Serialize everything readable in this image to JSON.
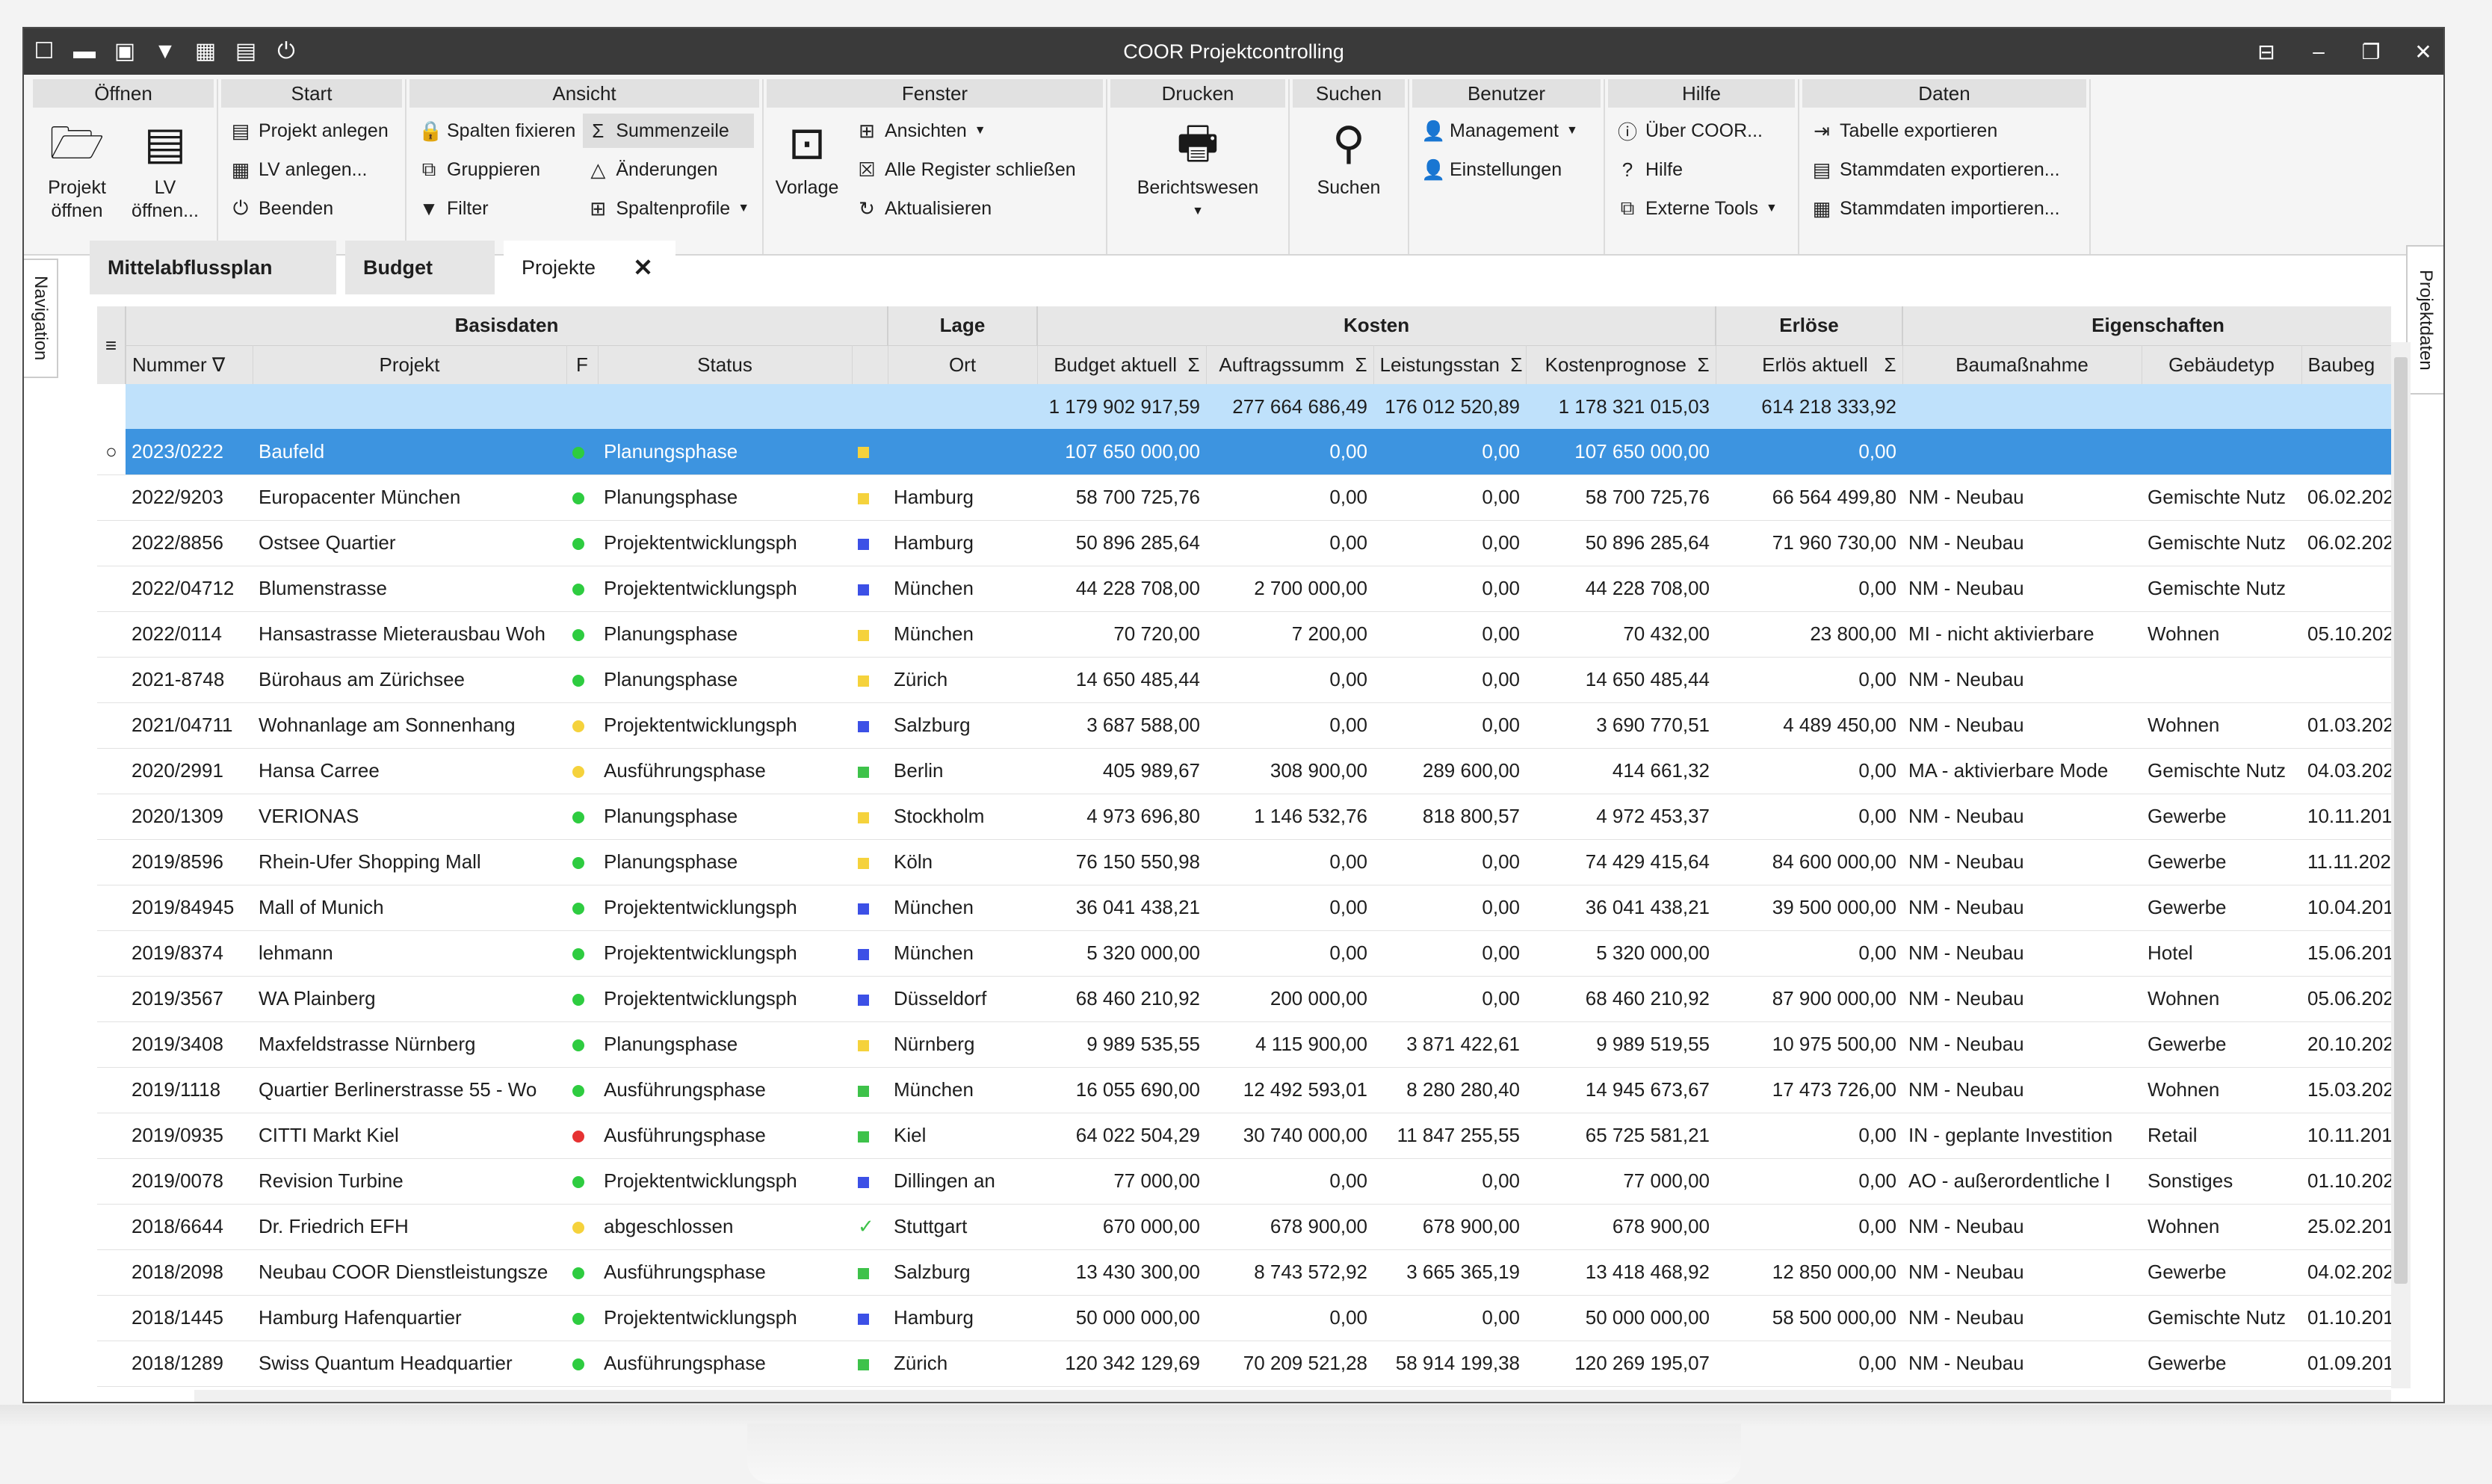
{
  "app": {
    "title": "COOR Projektcontrolling"
  },
  "toolbar_icons": [
    "window-icon",
    "folder-open-icon",
    "print-icon",
    "filter-icon",
    "calculator-icon",
    "layout-icon",
    "power-icon"
  ],
  "ribbon": {
    "oeffnen": {
      "header": "Öffnen",
      "projekt": "Projekt\nöffnen",
      "lv": "LV\nöffnen..."
    },
    "start": {
      "header": "Start",
      "items": [
        "Projekt anlegen",
        "LV anlegen...",
        "Beenden"
      ]
    },
    "ansicht": {
      "header": "Ansicht",
      "col1": [
        "Spalten fixieren",
        "Gruppieren",
        "Filter"
      ],
      "col2": [
        "Summenzeile",
        "Änderungen",
        "Spaltenprofile"
      ]
    },
    "fenster": {
      "header": "Fenster",
      "vorlage": "Vorlage",
      "items": [
        "Ansichten",
        "Alle Register schließen",
        "Aktualisieren"
      ]
    },
    "drucken": {
      "header": "Drucken",
      "berichtswesen": "Berichtswesen"
    },
    "suchen": {
      "header": "Suchen",
      "suchen": "Suchen"
    },
    "benutzer": {
      "header": "Benutzer",
      "items": [
        "Management",
        "Einstellungen"
      ]
    },
    "hilfe": {
      "header": "Hilfe",
      "items": [
        "Über COOR...",
        "Hilfe",
        "Externe Tools"
      ]
    },
    "daten": {
      "header": "Daten",
      "items": [
        "Tabelle exportieren",
        "Stammdaten exportieren...",
        "Stammdaten importieren..."
      ]
    }
  },
  "side": {
    "navigation": "Navigation",
    "projektdaten": "Projektdaten"
  },
  "tabs": [
    {
      "label": "Mittelabflussplan"
    },
    {
      "label": "Budget"
    },
    {
      "label": "Projekte"
    }
  ],
  "tab_close": "✕",
  "grid": {
    "groups": [
      "Basisdaten",
      "Lage",
      "Kosten",
      "Erlöse",
      "Eigenschaften"
    ],
    "columns": [
      "Nummer",
      "Projekt",
      "F",
      "Status",
      "",
      "Ort",
      "Budget aktuell",
      "Auftragssumm",
      "Leistungsstan",
      "Kostenprognose",
      "Erlös aktuell",
      "Baumaßnahme",
      "Gebäudetyp",
      "Baubeg"
    ],
    "sum_symbol": "Σ",
    "sums": {
      "budget": "1 179 902 917,59",
      "auftrag": "277 664 686,49",
      "leistung": "176 012 520,89",
      "prognose": "1 178 321 015,03",
      "erloes": "614 218 333,92"
    },
    "rows": [
      {
        "nr": "2023/0222",
        "projekt": "Baufeld",
        "f": "#2ecc40",
        "status": "Planungsphase",
        "lage": "#f5d23c",
        "ort": "",
        "budget": "107 650 000,00",
        "auftrag": "0,00",
        "leistung": "0,00",
        "prognose": "107 650 000,00",
        "erloes": "0,00",
        "bau": "",
        "typ": "",
        "beg": ""
      },
      {
        "nr": "2022/9203",
        "projekt": "Europacenter München",
        "f": "#2ecc40",
        "status": "Planungsphase",
        "lage": "#f5d23c",
        "ort": "Hamburg",
        "budget": "58 700 725,76",
        "auftrag": "0,00",
        "leistung": "0,00",
        "prognose": "58 700 725,76",
        "erloes": "66 564 499,80",
        "bau": "NM - Neubau",
        "typ": "Gemischte Nutz",
        "beg": "06.02.202"
      },
      {
        "nr": "2022/8856",
        "projekt": "Ostsee Quartier",
        "f": "#2ecc40",
        "status": "Projektentwicklungsph",
        "lage": "#3c50e6",
        "ort": "Hamburg",
        "budget": "50 896 285,64",
        "auftrag": "0,00",
        "leistung": "0,00",
        "prognose": "50 896 285,64",
        "erloes": "71 960 730,00",
        "bau": "NM - Neubau",
        "typ": "Gemischte Nutz",
        "beg": "06.02.202"
      },
      {
        "nr": "2022/04712",
        "projekt": "Blumenstrasse",
        "f": "#2ecc40",
        "status": "Projektentwicklungsph",
        "lage": "#3c50e6",
        "ort": "München",
        "budget": "44 228 708,00",
        "auftrag": "2 700 000,00",
        "leistung": "0,00",
        "prognose": "44 228 708,00",
        "erloes": "0,00",
        "bau": "NM - Neubau",
        "typ": "Gemischte Nutz",
        "beg": ""
      },
      {
        "nr": "2022/0114",
        "projekt": "Hansastrasse Mieterausbau Woh",
        "f": "#2ecc40",
        "status": "Planungsphase",
        "lage": "#f5d23c",
        "ort": "München",
        "budget": "70 720,00",
        "auftrag": "7 200,00",
        "leistung": "0,00",
        "prognose": "70 432,00",
        "erloes": "23 800,00",
        "bau": "MI - nicht aktivierbare",
        "typ": "Wohnen",
        "beg": "05.10.202"
      },
      {
        "nr": "2021-8748",
        "projekt": "Bürohaus am Zürichsee",
        "f": "#2ecc40",
        "status": "Planungsphase",
        "lage": "#f5d23c",
        "ort": "Zürich",
        "budget": "14 650 485,44",
        "auftrag": "0,00",
        "leistung": "0,00",
        "prognose": "14 650 485,44",
        "erloes": "0,00",
        "bau": "NM - Neubau",
        "typ": "",
        "beg": ""
      },
      {
        "nr": "2021/04711",
        "projekt": "Wohnanlage am Sonnenhang",
        "f": "#f5d23c",
        "status": "Projektentwicklungsph",
        "lage": "#3c50e6",
        "ort": "Salzburg",
        "budget": "3 687 588,00",
        "auftrag": "0,00",
        "leistung": "0,00",
        "prognose": "3 690 770,51",
        "erloes": "4 489 450,00",
        "bau": "NM - Neubau",
        "typ": "Wohnen",
        "beg": "01.03.202"
      },
      {
        "nr": "2020/2991",
        "projekt": "Hansa Carree",
        "f": "#f5d23c",
        "status": "Ausführungsphase",
        "lage": "#3ec24a",
        "ort": "Berlin",
        "budget": "405 989,67",
        "auftrag": "308 900,00",
        "leistung": "289 600,00",
        "prognose": "414 661,32",
        "erloes": "0,00",
        "bau": "MA - aktivierbare Mode",
        "typ": "Gemischte Nutz",
        "beg": "04.03.202"
      },
      {
        "nr": "2020/1309",
        "projekt": "VERIONAS",
        "f": "#2ecc40",
        "status": "Planungsphase",
        "lage": "#f5d23c",
        "ort": "Stockholm",
        "budget": "4 973 696,80",
        "auftrag": "1 146 532,76",
        "leistung": "818 800,57",
        "prognose": "4 972 453,37",
        "erloes": "0,00",
        "bau": "NM - Neubau",
        "typ": "Gewerbe",
        "beg": "10.11.201"
      },
      {
        "nr": "2019/8596",
        "projekt": "Rhein-Ufer Shopping Mall",
        "f": "#2ecc40",
        "status": "Planungsphase",
        "lage": "#f5d23c",
        "ort": "Köln",
        "budget": "76 150 550,98",
        "auftrag": "0,00",
        "leistung": "0,00",
        "prognose": "74 429 415,64",
        "erloes": "84 600 000,00",
        "bau": "NM - Neubau",
        "typ": "Gewerbe",
        "beg": "11.11.202"
      },
      {
        "nr": "2019/84945",
        "projekt": "Mall of Munich",
        "f": "#2ecc40",
        "status": "Projektentwicklungsph",
        "lage": "#3c50e6",
        "ort": "München",
        "budget": "36 041 438,21",
        "auftrag": "0,00",
        "leistung": "0,00",
        "prognose": "36 041 438,21",
        "erloes": "39 500 000,00",
        "bau": "NM - Neubau",
        "typ": "Gewerbe",
        "beg": "10.04.201"
      },
      {
        "nr": "2019/8374",
        "projekt": "lehmann",
        "f": "#2ecc40",
        "status": "Projektentwicklungsph",
        "lage": "#3c50e6",
        "ort": "München",
        "budget": "5 320 000,00",
        "auftrag": "0,00",
        "leistung": "0,00",
        "prognose": "5 320 000,00",
        "erloes": "0,00",
        "bau": "NM - Neubau",
        "typ": "Hotel",
        "beg": "15.06.201"
      },
      {
        "nr": "2019/3567",
        "projekt": "WA Plainberg",
        "f": "#2ecc40",
        "status": "Projektentwicklungsph",
        "lage": "#3c50e6",
        "ort": "Düsseldorf",
        "budget": "68 460 210,92",
        "auftrag": "200 000,00",
        "leistung": "0,00",
        "prognose": "68 460 210,92",
        "erloes": "87 900 000,00",
        "bau": "NM - Neubau",
        "typ": "Wohnen",
        "beg": "05.06.202"
      },
      {
        "nr": "2019/3408",
        "projekt": "Maxfeldstrasse Nürnberg",
        "f": "#2ecc40",
        "status": "Planungsphase",
        "lage": "#f5d23c",
        "ort": "Nürnberg",
        "budget": "9 989 535,55",
        "auftrag": "4 115 900,00",
        "leistung": "3 871 422,61",
        "prognose": "9 989 519,55",
        "erloes": "10 975 500,00",
        "bau": "NM - Neubau",
        "typ": "Gewerbe",
        "beg": "20.10.202"
      },
      {
        "nr": "2019/1118",
        "projekt": "Quartier Berlinerstrasse 55 - Wo",
        "f": "#2ecc40",
        "status": "Ausführungsphase",
        "lage": "#3ec24a",
        "ort": "München",
        "budget": "16 055 690,00",
        "auftrag": "12 492 593,01",
        "leistung": "8 280 280,40",
        "prognose": "14 945 673,67",
        "erloes": "17 473 726,00",
        "bau": "NM - Neubau",
        "typ": "Wohnen",
        "beg": "15.03.202"
      },
      {
        "nr": "2019/0935",
        "projekt": "CITTI Markt Kiel",
        "f": "#e63232",
        "status": "Ausführungsphase",
        "lage": "#3ec24a",
        "ort": "Kiel",
        "budget": "64 022 504,29",
        "auftrag": "30 740 000,00",
        "leistung": "11 847 255,55",
        "prognose": "65 725 581,21",
        "erloes": "0,00",
        "bau": "IN - geplante Investition",
        "typ": "Retail",
        "beg": "10.11.201"
      },
      {
        "nr": "2019/0078",
        "projekt": "Revision Turbine",
        "f": "#2ecc40",
        "status": "Projektentwicklungsph",
        "lage": "#3c50e6",
        "ort": "Dillingen an",
        "budget": "77 000,00",
        "auftrag": "0,00",
        "leistung": "0,00",
        "prognose": "77 000,00",
        "erloes": "0,00",
        "bau": "AO - außerordentliche I",
        "typ": "Sonstiges",
        "beg": "01.10.202"
      },
      {
        "nr": "2018/6644",
        "projekt": "Dr. Friedrich EFH",
        "f": "#f5d23c",
        "status": "abgeschlossen",
        "lage": "check",
        "ort": "Stuttgart",
        "budget": "670 000,00",
        "auftrag": "678 900,00",
        "leistung": "678 900,00",
        "prognose": "678 900,00",
        "erloes": "0,00",
        "bau": "NM - Neubau",
        "typ": "Wohnen",
        "beg": "25.02.201"
      },
      {
        "nr": "2018/2098",
        "projekt": "Neubau COOR Dienstleistungsze",
        "f": "#2ecc40",
        "status": "Ausführungsphase",
        "lage": "#3ec24a",
        "ort": "Salzburg",
        "budget": "13 430 300,00",
        "auftrag": "8 743 572,92",
        "leistung": "3 665 365,19",
        "prognose": "13 418 468,92",
        "erloes": "12 850 000,00",
        "bau": "NM - Neubau",
        "typ": "Gewerbe",
        "beg": "04.02.202"
      },
      {
        "nr": "2018/1445",
        "projekt": "Hamburg Hafenquartier",
        "f": "#2ecc40",
        "status": "Projektentwicklungsph",
        "lage": "#3c50e6",
        "ort": "Hamburg",
        "budget": "50 000 000,00",
        "auftrag": "0,00",
        "leistung": "0,00",
        "prognose": "50 000 000,00",
        "erloes": "58 500 000,00",
        "bau": "NM - Neubau",
        "typ": "Gemischte Nutz",
        "beg": "01.10.201"
      },
      {
        "nr": "2018/1289",
        "projekt": "Swiss Quantum Headquartier",
        "f": "#2ecc40",
        "status": "Ausführungsphase",
        "lage": "#3ec24a",
        "ort": "Zürich",
        "budget": "120 342 129,69",
        "auftrag": "70 209 521,28",
        "leistung": "58 914 199,38",
        "prognose": "120 269 195,07",
        "erloes": "0,00",
        "bau": "NM - Neubau",
        "typ": "Gewerbe",
        "beg": "01.09.201"
      }
    ]
  }
}
